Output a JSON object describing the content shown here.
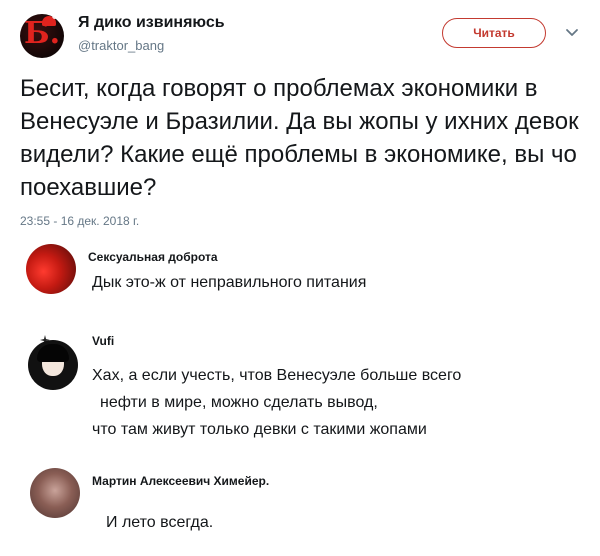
{
  "tweet": {
    "author_name": "Я дико извиняюсь",
    "author_handle": "@traktor_bang",
    "avatar_letter": "Б.",
    "follow_label": "Читать",
    "text": "Бесит, когда говорят о проблемах экономики в Венесуэле и Бразилии. Да вы жопы у ихних девок видели? Какие ещё проблемы в экономике, вы чо поехавшие?",
    "timestamp": "23:55 - 16 дек. 2018 г."
  },
  "comments": [
    {
      "name": "Сексуальная доброта",
      "lines": [
        "Дык это-ж от неправильного питания"
      ]
    },
    {
      "name": "Vufi",
      "lines": [
        "Хах, а если учесть, чтов Венесуэле больше всего",
        "нефти в мире, можно сделать вывод,",
        "что там живут только девки с такими жопами"
      ]
    },
    {
      "name": "Мартин Алексеевич Химейер.",
      "lines": [
        "И лето всегда."
      ]
    }
  ],
  "colors": {
    "accent": "#c33a30",
    "muted": "#657786",
    "text": "#14171a"
  },
  "icons": {
    "menu": "chevron-down-icon"
  }
}
